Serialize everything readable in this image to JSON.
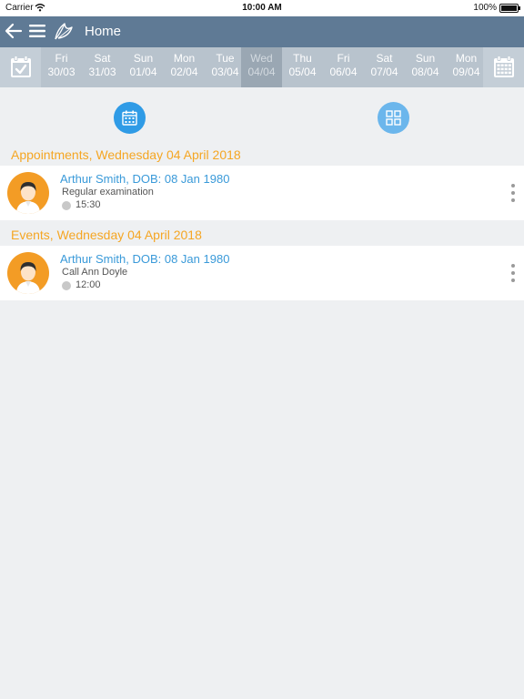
{
  "status_bar": {
    "carrier": "Carrier",
    "time": "10:00 AM",
    "battery": "100%"
  },
  "nav": {
    "title": "Home",
    "icons": [
      "back-arrow-icon",
      "hamburger-menu-icon",
      "app-logo-icon"
    ]
  },
  "date_strip": {
    "days": [
      {
        "name": "Fri",
        "date": "30/03"
      },
      {
        "name": "Sat",
        "date": "31/03"
      },
      {
        "name": "Sun",
        "date": "01/04"
      },
      {
        "name": "Mon",
        "date": "02/04"
      },
      {
        "name": "Tue",
        "date": "03/04"
      },
      {
        "name": "Wed",
        "date": "04/04",
        "selected": true
      },
      {
        "name": "Thu",
        "date": "05/04"
      },
      {
        "name": "Fri",
        "date": "06/04"
      },
      {
        "name": "Sat",
        "date": "07/04"
      },
      {
        "name": "Sun",
        "date": "08/04"
      },
      {
        "name": "Mon",
        "date": "09/04"
      }
    ]
  },
  "sections": {
    "appointments_header": "Appointments, Wednesday 04 April 2018",
    "events_header": "Events, Wednesday 04 April 2018"
  },
  "appointment": {
    "patient": "Arthur Smith, DOB: 08 Jan 1980",
    "description": "Regular examination",
    "time": "15:30"
  },
  "event": {
    "patient": "Arthur Smith, DOB: 08 Jan 1980",
    "description": "Call Ann Doyle",
    "time": "12:00"
  },
  "colors": {
    "nav_bar": "#5f7a95",
    "date_strip": "#b8c3cd",
    "accent_blue": "#2f9be6",
    "section_orange": "#f5a623",
    "avatar_orange": "#f39c25",
    "link_blue": "#3a9ad9"
  }
}
